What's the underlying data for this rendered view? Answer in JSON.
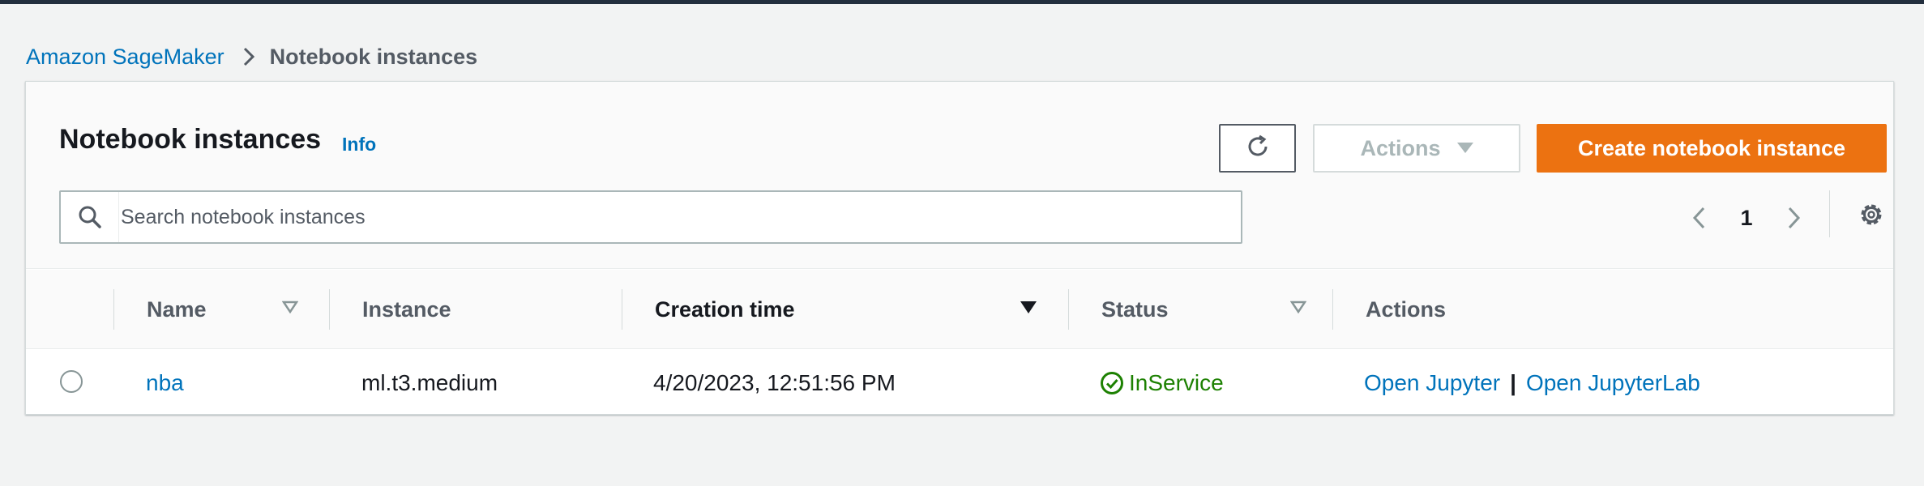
{
  "breadcrumb": {
    "root": "Amazon SageMaker",
    "current": "Notebook instances"
  },
  "header": {
    "title": "Notebook instances",
    "info": "Info"
  },
  "toolbar": {
    "refresh_icon": "refresh-icon",
    "actions_label": "Actions",
    "create_label": "Create notebook instance"
  },
  "search": {
    "placeholder": "Search notebook instances",
    "value": ""
  },
  "pagination": {
    "current_page": "1"
  },
  "table": {
    "columns": [
      "Name",
      "Instance",
      "Creation time",
      "Status",
      "Actions"
    ],
    "sorted_column": "Creation time",
    "rows": [
      {
        "name": "nba",
        "instance": "ml.t3.medium",
        "creation_time": "4/20/2023, 12:51:56 PM",
        "status": "InService",
        "actions": [
          "Open Jupyter",
          "Open JupyterLab"
        ],
        "separator": "|"
      }
    ]
  },
  "colors": {
    "primary": "#ec7211",
    "link": "#0073bb",
    "success": "#1d8102",
    "topbar": "#232f3e"
  }
}
